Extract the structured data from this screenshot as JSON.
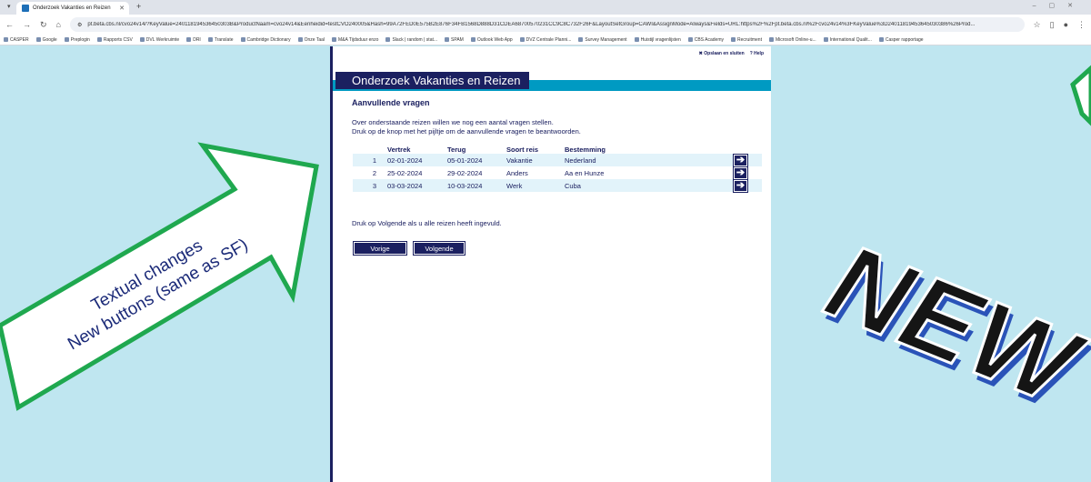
{
  "browser": {
    "tab_title": "Onderzoek Vakanties en Reizen",
    "url": "pt.beta.cbs.nl/cvo24v14/?KeyValue=240118194536450303B&ProductNaam=cvo24v14&Eenheidid=testCVO240005&Hash=99A72FED0E575B2E876F34FB1568D888D31CDEA68700570231CC9C8C732F26F&LayoutSetGroup=CAWI&AssignMode=Always&Fields=URL:https%2F%2Fpt.beta.cbs.nl%2Fcvo24v14%3FKeyValue%3D24011819453645030386%26Prod...",
    "bookmarks": [
      "CASPER",
      "Google",
      "Preplogin",
      "Rapports CSV",
      "DVL Werkruimte",
      "DRI",
      "Translate",
      "Cambridge Dictionary",
      "Onze Taal",
      "M&A Tijdsduur enzo",
      "Slack | random | stat...",
      "SPAM",
      "Outlook Web App",
      "DVZ Centrale Planni...",
      "Survey Management",
      "Huistijl vragenlijsten",
      "CBS Academy",
      "Recruitment",
      "Microsoft Online-u...",
      "International Qualit...",
      "Casper rapportage"
    ]
  },
  "survey": {
    "topnav_close": "✖ Opslaan en sluiten",
    "topnav_help": "? Help",
    "title": "Onderzoek Vakanties en Reizen",
    "section_title": "Aanvullende vragen",
    "intro_line1": "Over onderstaande reizen willen we nog een aantal vragen stellen.",
    "intro_line2": "Druk op de knop met het pijltje om de aanvullende vragen te beantwoorden.",
    "columns": [
      "Vertrek",
      "Terug",
      "Soort reis",
      "Bestemming"
    ],
    "rows": [
      {
        "n": "1",
        "vertrek": "02-01-2024",
        "terug": "05-01-2024",
        "soort": "Vakantie",
        "bestemming": "Nederland"
      },
      {
        "n": "2",
        "vertrek": "25-02-2024",
        "terug": "29-02-2024",
        "soort": "Anders",
        "bestemming": "Aa en Hunze"
      },
      {
        "n": "3",
        "vertrek": "03-03-2024",
        "terug": "10-03-2024",
        "soort": "Werk",
        "bestemming": "Cuba"
      }
    ],
    "arrow_symbol": "➔",
    "finish_text": "Druk op Volgende als u alle reizen heeft ingevuld.",
    "prev_label": "Vorige",
    "next_label": "Volgende"
  },
  "annotation": {
    "line1": "Textual changes",
    "line2": "New buttons (same as SF)",
    "new_label": "NEW"
  },
  "colors": {
    "background": "#bfe6f0",
    "navy": "#1b2060",
    "band": "#009ac2",
    "arrow_green": "#1fa84f",
    "new_shadow": "#2a53b8"
  }
}
